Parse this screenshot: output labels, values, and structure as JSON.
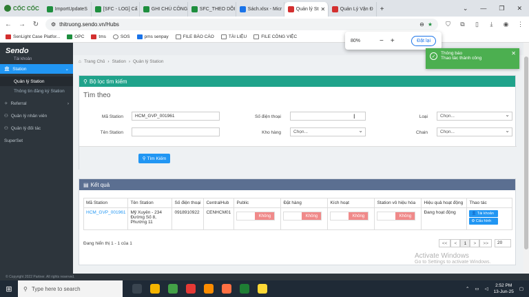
{
  "browser": {
    "brand": "CỐC CỐC",
    "tabs": [
      {
        "label": "ImportUpdateS",
        "favicon": "sheet"
      },
      {
        "label": "[SFC - LOG] Cấ",
        "favicon": "sheet"
      },
      {
        "label": "GHI CHÚ CÔNG",
        "favicon": "sheet"
      },
      {
        "label": "SFC_THEO DÕI",
        "favicon": "sheet"
      },
      {
        "label": "Sách.xlsx - Micr",
        "favicon": "excel"
      },
      {
        "label": "Quản lý St",
        "favicon": "sendo",
        "active": true
      },
      {
        "label": "Quản Lý Vận Đ",
        "favicon": "sendo"
      }
    ],
    "new_tab": "+",
    "url": "thitruong.sendo.vn/Hubs",
    "bookmarks": [
      "SenLight Case Platfor...",
      "OPC",
      "tms",
      "SOS",
      "pms senpay",
      "FILE BÁO CÁO",
      "TÀI LIỆU",
      "FILE CÔNG VIỆC"
    ],
    "zoom": {
      "level": "80%",
      "minus": "−",
      "plus": "+",
      "reset_label": "Đặt lại"
    }
  },
  "sidebar": {
    "logo": "Sendo",
    "account": "Tài khoản",
    "station": "Station",
    "sub_items": [
      "Quản lý Station",
      "Thông tin đăng ký Station"
    ],
    "items": [
      "Referral",
      "Quản lý nhân viên",
      "Quản lý đối tác",
      "SuperSet"
    ],
    "footer": "© Copyright 2022 Partner. All rights reserved."
  },
  "breadcrumb": [
    "Trang Chủ",
    "Station",
    "Quản lý Station"
  ],
  "filter": {
    "header": "Bộ lọc tìm kiếm",
    "title": "Tìm theo",
    "ma_station_label": "Mã Station",
    "ma_station_value": "HCM_GVP_001961",
    "ten_station_label": "Tên Station",
    "ten_station_value": "",
    "phone_label": "Số điện thoại",
    "phone_value": "",
    "kho_hang_label": "Kho hàng",
    "kho_hang_value": "Chọn...",
    "loai_label": "Loại",
    "loai_value": "Chọn...",
    "chain_label": "Chain",
    "chain_value": "Chọn...",
    "search_button": "Tìm Kiếm"
  },
  "results": {
    "header": "Kết quả",
    "columns": [
      "Mã Station",
      "Tên Station",
      "Số điện thoại",
      "CentralHub",
      "Public",
      "Đặt hàng",
      "Kích hoạt",
      "Station vô hiệu hóa",
      "Hiệu quả hoạt động",
      "Thao tác"
    ],
    "rows": [
      {
        "ma": "HCM_GVP_001961",
        "ten": "Mỹ Xuyên - 234 Đường Số 8, Phường 11",
        "phone": "0918910922",
        "hub": "CENHCM01",
        "public": "Không",
        "dat_hang": "Không",
        "kich_hoat": "Không",
        "vo_hieu": "Không",
        "hieu_qua": "Đang hoạt động",
        "actions": [
          "Tài khoản",
          "Cấu hình"
        ]
      }
    ],
    "info": "Đang hiển thị 1 - 1 của 1",
    "pager": [
      "<<",
      "<",
      "1",
      ">",
      ">>"
    ],
    "page_size": "20"
  },
  "toast": {
    "title": "Thông báo",
    "message": "Thao tác thành công"
  },
  "watermark": {
    "line1": "Activate Windows",
    "line2": "Go to Settings to activate Windows."
  },
  "taskbar": {
    "search_placeholder": "Type here to search",
    "time": "2:52 PM",
    "date": "13-Jun-25"
  },
  "colors": {
    "sidebar": "#2d353c",
    "accent": "#2196f3",
    "filter_header": "#20a38b",
    "result_header": "#5b6f91",
    "toast": "#4caf50"
  }
}
